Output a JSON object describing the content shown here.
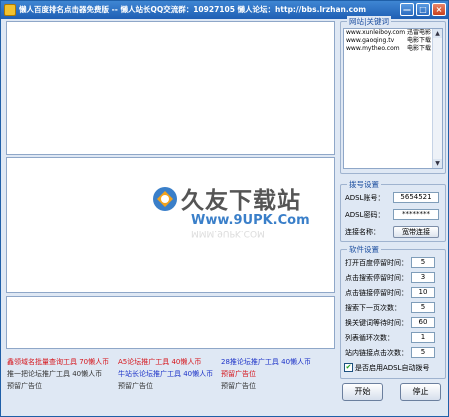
{
  "window": {
    "title": "懒人百度排名点击器免费版 -- 懒人站长QQ交流群：10927105 懒人论坛：http://bbs.lrzhan.com",
    "min_glyph": "—",
    "max_glyph": "□",
    "close_glyph": "×"
  },
  "watermark": {
    "title": "久友下载站",
    "url": "Www.9UPK.Com",
    "reflection": "MMM.9UPK.COM"
  },
  "ads": {
    "row1": [
      {
        "text": "鑫领域名批量查询工具 70懒人币"
      },
      {
        "text": "A5论坛推广工具 40懒人币"
      },
      {
        "text": "28推论坛推广工具 40懒人币"
      }
    ],
    "row2": [
      {
        "text": "推一把论坛推广工具 40懒人币"
      },
      {
        "text": "牛站长论坛推广工具 40懒人币"
      },
      {
        "text": "预留广告位"
      }
    ],
    "row3": [
      {
        "text": "预留广告位"
      },
      {
        "text": "预留广告位"
      },
      {
        "text": "预留广告位"
      }
    ]
  },
  "keywords": {
    "title": "网站|关键词",
    "items": [
      {
        "url": "www.xunleiboy.com",
        "kw": "迅雷电影"
      },
      {
        "url": "www.gaoqing.tv",
        "kw": "电影下载"
      },
      {
        "url": "www.mytheo.com",
        "kw": "电影下载"
      }
    ],
    "scroll_up": "▲",
    "scroll_down": "▼"
  },
  "adsl": {
    "title": "拨号设置",
    "account_label": "ADSL账号：",
    "account_value": "5654521",
    "password_label": "ADSL密码：",
    "password_value": "********",
    "connection_label": "连接名称：",
    "connection_value": "宽带连接"
  },
  "settings": {
    "title": "软件设置",
    "rows": [
      {
        "label": "打开百度停留时间：",
        "value": "5"
      },
      {
        "label": "点击搜索停留时间：",
        "value": "3"
      },
      {
        "label": "点击链接停留时间：",
        "value": "10"
      },
      {
        "label": "搜索下一页次数：",
        "value": "5"
      },
      {
        "label": "换关键词等待时间：",
        "value": "60"
      },
      {
        "label": "列表循环次数：",
        "value": "1"
      },
      {
        "label": "站内链接点击次数：",
        "value": "5"
      }
    ],
    "auto_dial_label": "是否启用ADSL自动拨号",
    "auto_dial_checked": true,
    "check_glyph": "✔"
  },
  "buttons": {
    "start": "开始",
    "stop": "停止"
  },
  "colors": {
    "title_bar": "#2a6fc4",
    "ad_red": "#d6151b",
    "ad_blue": "#1d33c8",
    "group_title": "#1d4fa0",
    "watermark_blue": "#3a7fc9"
  }
}
